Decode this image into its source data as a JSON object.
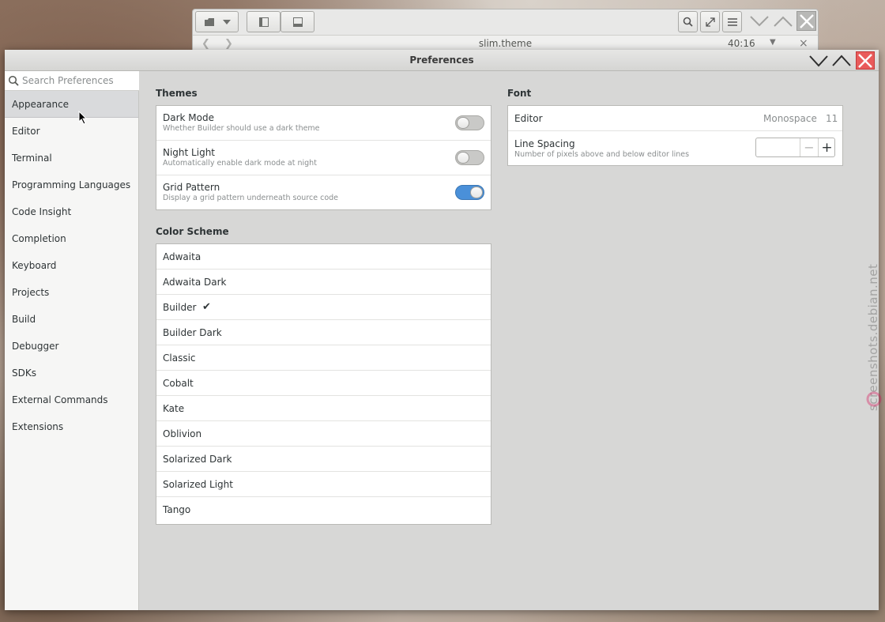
{
  "background_window": {
    "filename": "slim.theme",
    "cursor_position": "40:16"
  },
  "dialog": {
    "title": "Preferences"
  },
  "sidebar": {
    "search_placeholder": "Search Preferences",
    "items": [
      {
        "label": "Appearance",
        "selected": true
      },
      {
        "label": "Editor"
      },
      {
        "label": "Terminal"
      },
      {
        "label": "Programming Languages"
      },
      {
        "label": "Code Insight"
      },
      {
        "label": "Completion"
      },
      {
        "label": "Keyboard"
      },
      {
        "label": "Projects"
      },
      {
        "label": "Build"
      },
      {
        "label": "Debugger"
      },
      {
        "label": "SDKs"
      },
      {
        "label": "External Commands"
      },
      {
        "label": "Extensions"
      }
    ]
  },
  "themes": {
    "title": "Themes",
    "rows": [
      {
        "label": "Dark Mode",
        "subtitle": "Whether Builder should use a dark theme",
        "enabled": false
      },
      {
        "label": "Night Light",
        "subtitle": "Automatically enable dark mode at night",
        "enabled": false
      },
      {
        "label": "Grid Pattern",
        "subtitle": "Display a grid pattern underneath source code",
        "enabled": true
      }
    ]
  },
  "color_scheme": {
    "title": "Color Scheme",
    "items": [
      {
        "label": "Adwaita"
      },
      {
        "label": "Adwaita Dark"
      },
      {
        "label": "Builder",
        "selected": true
      },
      {
        "label": "Builder Dark"
      },
      {
        "label": "Classic"
      },
      {
        "label": "Cobalt"
      },
      {
        "label": "Kate"
      },
      {
        "label": "Oblivion"
      },
      {
        "label": "Solarized Dark"
      },
      {
        "label": "Solarized Light"
      },
      {
        "label": "Tango"
      }
    ]
  },
  "font": {
    "title": "Font",
    "editor_label": "Editor",
    "editor_font": "Monospace",
    "editor_size": "11",
    "line_spacing_label": "Line Spacing",
    "line_spacing_subtitle": "Number of pixels above and below editor lines",
    "line_spacing_value": ""
  },
  "watermark": "screenshots.debian.net",
  "colors": {
    "toggle_on": "#4a90d9",
    "close_button": "#e95b5b"
  }
}
